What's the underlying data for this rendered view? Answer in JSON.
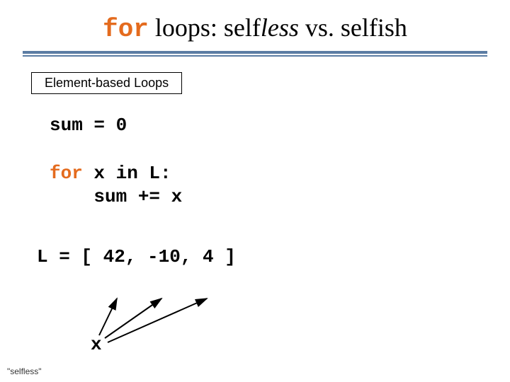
{
  "title": {
    "kw": "for",
    "mid1": " loops: self",
    "ital": "less",
    "mid2": " vs. selfish"
  },
  "badge": "Element-based Loops",
  "code": {
    "line1": "sum = 0",
    "line2_kw": "for",
    "line2_rest": " x in L:",
    "line3": "    sum += x"
  },
  "list_line": "L = [ 42, -10, 4 ]",
  "x_label": "x",
  "footer": "\"selfless\""
}
